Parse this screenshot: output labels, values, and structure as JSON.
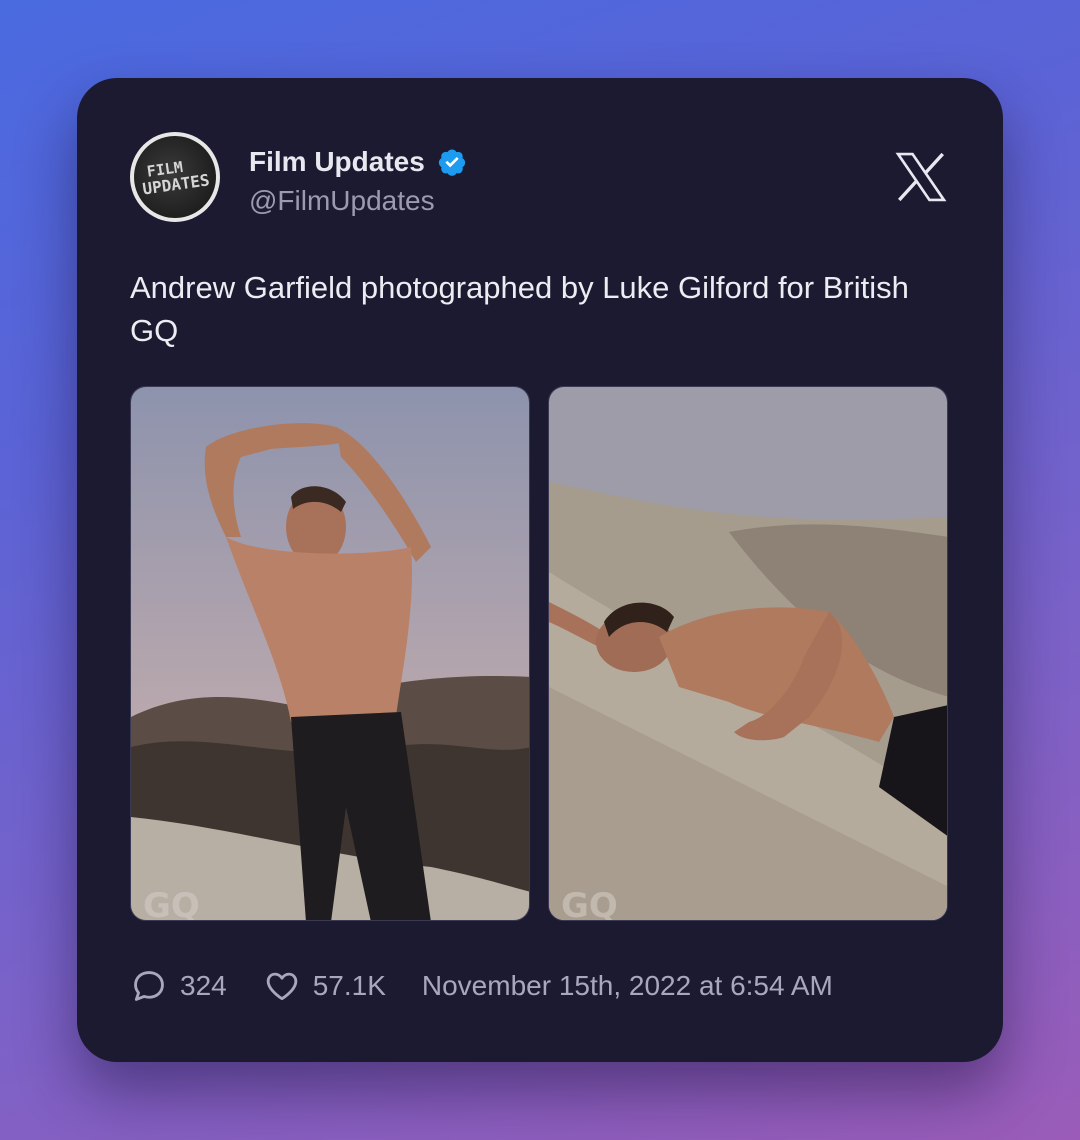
{
  "tweet": {
    "display_name": "Film Updates",
    "handle": "@FilmUpdates",
    "avatar_text": [
      "FILM",
      "UPDATES"
    ],
    "verified_icon": "verified-badge-icon",
    "platform_icon": "x-logo-icon",
    "text": "Andrew Garfield photographed by Luke Gilford for British GQ",
    "images": [
      {
        "watermark": "GQ",
        "description_icon": "photo-man-standing-desert"
      },
      {
        "watermark": "GQ",
        "description_icon": "photo-man-lying-sand-dune"
      }
    ],
    "replies": "324",
    "likes": "57.1K",
    "timestamp": "November 15th, 2022 at 6:54 AM"
  },
  "colors": {
    "card_bg": "#1b1a30",
    "verified": "#1d9bf0",
    "muted_text": "#a8a8bc"
  }
}
